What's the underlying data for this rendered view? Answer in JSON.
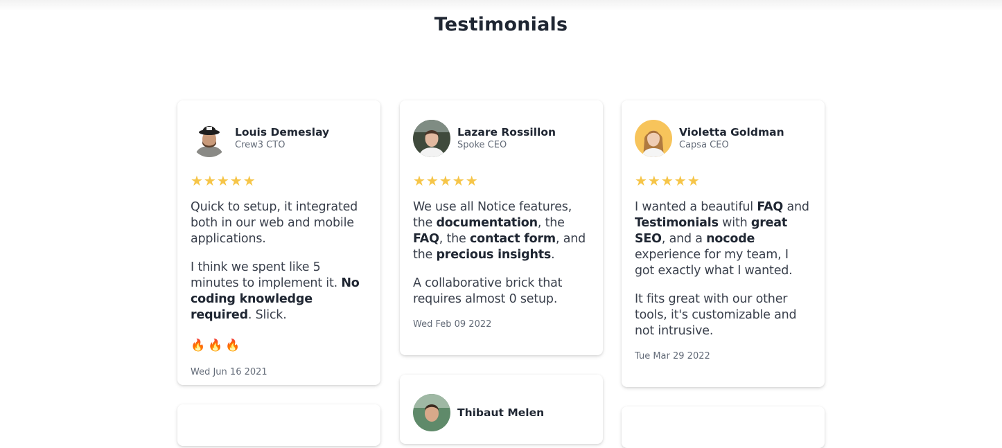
{
  "page": {
    "title": "Testimonials"
  },
  "colors": {
    "star": "#f6c548",
    "text_dark": "#1f2632",
    "text_muted": "#636b78"
  },
  "cards": [
    {
      "name": "Louis Demeslay",
      "role": "Crew3 CTO",
      "stars": "★★★★★",
      "rating": 5,
      "p1": {
        "t1": "Quick to setup, it integrated both in our web and mobile applications."
      },
      "p2": {
        "t1": "I think we spent like 5 minutes to implement it. ",
        "b1": "No coding knowledge required",
        "t2": ". Slick."
      },
      "reaction": "🔥🔥🔥",
      "date": "Wed Jun 16 2021"
    },
    {
      "name": "Lazare Rossillon",
      "role": "Spoke CEO",
      "stars": "★★★★★",
      "rating": 5,
      "p1": {
        "t1": "We use all Notice features, the ",
        "b1": "documentation",
        "t2": ", the ",
        "b2": "FAQ",
        "t3": ", the ",
        "b3": "contact form",
        "t4": ", and the ",
        "b4": "precious insights",
        "t5": "."
      },
      "p2": {
        "t1": "A collaborative brick that requires almost 0 setup."
      },
      "date": "Wed Feb 09 2022"
    },
    {
      "name": "Violetta Goldman",
      "role": "Capsa CEO",
      "stars": "★★★★★",
      "rating": 5,
      "p1": {
        "t1": "I wanted a beautiful ",
        "b1": "FAQ",
        "t2": " and ",
        "b2": "Testimonials",
        "t3": " with ",
        "b3": "great SEO",
        "t4": ", and a ",
        "b4": "nocode",
        "t5": " experience for my team, I got exactly what I wanted."
      },
      "p2": {
        "t1": "It fits great with our other tools, it's customizable and not intrusive."
      },
      "date": "Tue Mar 29 2022"
    },
    {
      "name": "Thibaut Melen"
    }
  ]
}
